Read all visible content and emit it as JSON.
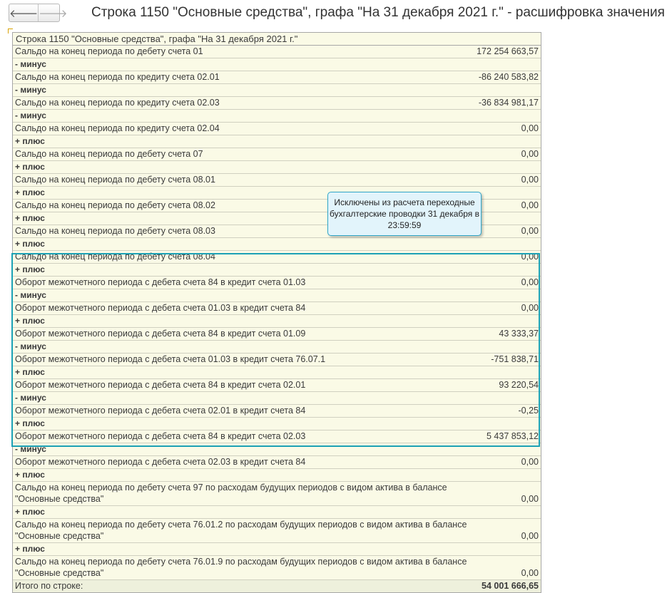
{
  "window": {
    "back_glyph": "🡐",
    "forward_glyph": "🡒",
    "title": "Строка 1150 \"Основные средства\", графа \"На 31 декабря 2021 г.\" - расшифровка значения"
  },
  "report": {
    "heading": "Строка 1150 \"Основные средства\", графа \"На 31 декабря 2021 г.\"",
    "rows": [
      {
        "label": "Сальдо на конец периода по дебету счета 01",
        "value": "172 254 663,57"
      },
      {
        "label": "- минус",
        "value": ""
      },
      {
        "label": "Сальдо на конец периода по кредиту счета 02.01",
        "value": "-86 240 583,82"
      },
      {
        "label": "- минус",
        "value": ""
      },
      {
        "label": "Сальдо на конец периода по кредиту счета 02.03",
        "value": "-36 834 981,17"
      },
      {
        "label": "- минус",
        "value": ""
      },
      {
        "label": "Сальдо на конец периода по кредиту счета 02.04",
        "value": "0,00"
      },
      {
        "label": "+ плюс",
        "value": ""
      },
      {
        "label": "Сальдо на конец периода по дебету счета 07",
        "value": "0,00"
      },
      {
        "label": "+ плюс",
        "value": ""
      },
      {
        "label": "Сальдо на конец периода по дебету счета 08.01",
        "value": "0,00"
      },
      {
        "label": "+ плюс",
        "value": ""
      },
      {
        "label": "Сальдо на конец периода по дебету счета 08.02",
        "value": "0,00"
      },
      {
        "label": "+ плюс",
        "value": ""
      },
      {
        "label": "Сальдо на конец периода по дебету счета 08.03",
        "value": "0,00"
      },
      {
        "label": "+ плюс",
        "value": ""
      },
      {
        "label": "Сальдо на конец периода по дебету счета 08.04",
        "value": "0,00"
      },
      {
        "label": "+ плюс",
        "value": ""
      },
      {
        "label": "Оборот межотчетного периода с дебета счета 84 в кредит счета 01.03",
        "value": "0,00"
      },
      {
        "label": "- минус",
        "value": ""
      },
      {
        "label": "Оборот межотчетного периода с дебета счета 01.03 в кредит счета 84",
        "value": "0,00"
      },
      {
        "label": "+ плюс",
        "value": ""
      },
      {
        "label": "Оборот межотчетного периода с дебета счета 84 в кредит счета 01.09",
        "value": "43 333,37"
      },
      {
        "label": "- минус",
        "value": ""
      },
      {
        "label": "Оборот межотчетного периода с дебета счета 01.03 в кредит счета 76.07.1",
        "value": "-751 838,71"
      },
      {
        "label": "+ плюс",
        "value": ""
      },
      {
        "label": "Оборот межотчетного периода с дебета счета 84 в кредит счета 02.01",
        "value": "93 220,54"
      },
      {
        "label": "- минус",
        "value": ""
      },
      {
        "label": "Оборот межотчетного периода с дебета счета 02.01 в кредит счета 84",
        "value": "-0,25"
      },
      {
        "label": "+ плюс",
        "value": ""
      },
      {
        "label": "Оборот межотчетного периода с дебета счета 84 в кредит счета 02.03",
        "value": "5 437 853,12"
      },
      {
        "label": "- минус",
        "value": ""
      },
      {
        "label": "Оборот межотчетного периода с дебета счета 02.03 в кредит счета 84",
        "value": "0,00"
      },
      {
        "label": "+ плюс",
        "value": ""
      },
      {
        "label": "Сальдо на конец периода по дебету счета 97 по расходам будущих периодов с видом актива в балансе \"Основные средства\"",
        "value": "0,00"
      },
      {
        "label": "+ плюс",
        "value": ""
      },
      {
        "label": "Сальдо на конец периода по дебету счета 76.01.2 по расходам будущих периодов с видом актива в балансе \"Основные средства\"",
        "value": "0,00"
      },
      {
        "label": "+ плюс",
        "value": ""
      },
      {
        "label": "Сальдо на конец периода по дебету счета 76.01.9 по расходам будущих периодов с видом актива в балансе \"Основные средства\"",
        "value": "0,00"
      }
    ],
    "total_label": "Итого по строке:",
    "total_value": "54 001 666,65"
  },
  "callout": {
    "text": "Исключены из расчета переходные бухгалтерские проводки 31 декабря в 23:59:59",
    "colors": {
      "highlight": "#1ba1b5",
      "callout_fill": "#e2f4fb"
    }
  }
}
